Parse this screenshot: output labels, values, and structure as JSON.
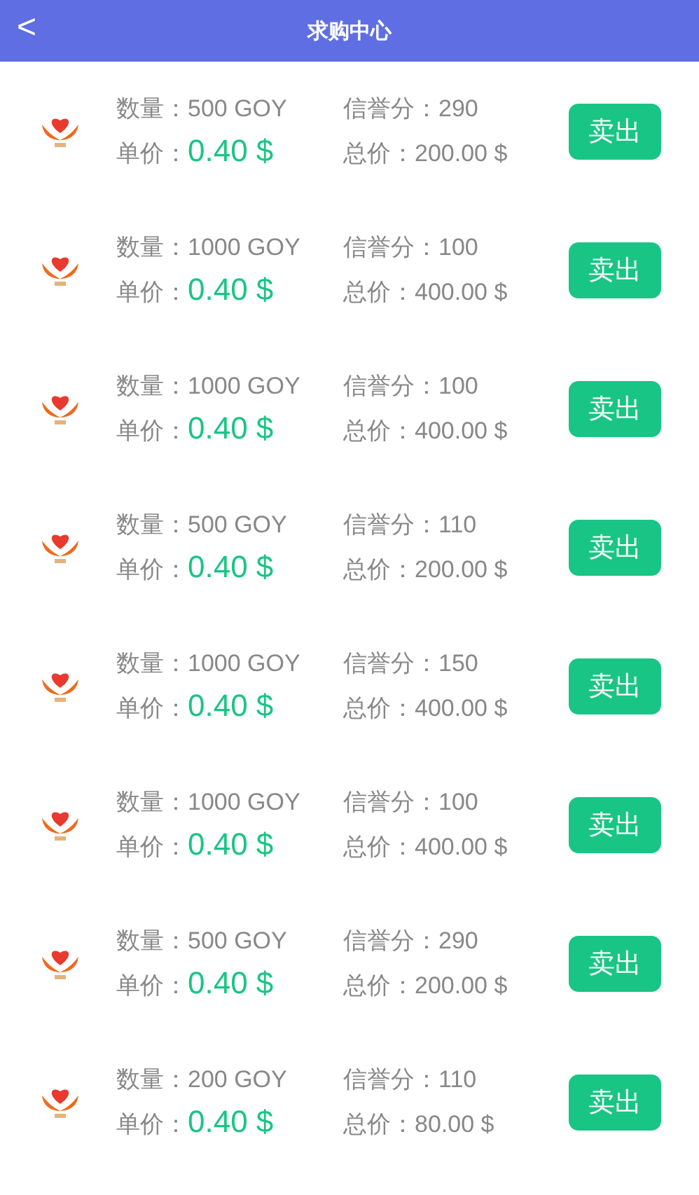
{
  "header": {
    "back": "<",
    "title": "求购中心"
  },
  "orders": [
    {
      "quantity_label": "数量：",
      "quantity": "500 GOY",
      "credit_label": "信誉分：",
      "credit": "290",
      "price_label": "单价：",
      "price": "0.40 $",
      "total_label": "总价：",
      "total": "200.00 $",
      "action": "卖出"
    },
    {
      "quantity_label": "数量：",
      "quantity": "1000 GOY",
      "credit_label": "信誉分：",
      "credit": "100",
      "price_label": "单价：",
      "price": "0.40 $",
      "total_label": "总价：",
      "total": "400.00 $",
      "action": "卖出"
    },
    {
      "quantity_label": "数量：",
      "quantity": "1000 GOY",
      "credit_label": "信誉分：",
      "credit": "100",
      "price_label": "单价：",
      "price": "0.40 $",
      "total_label": "总价：",
      "total": "400.00 $",
      "action": "卖出"
    },
    {
      "quantity_label": "数量：",
      "quantity": "500 GOY",
      "credit_label": "信誉分：",
      "credit": "110",
      "price_label": "单价：",
      "price": "0.40 $",
      "total_label": "总价：",
      "total": "200.00 $",
      "action": "卖出"
    },
    {
      "quantity_label": "数量：",
      "quantity": "1000 GOY",
      "credit_label": "信誉分：",
      "credit": "150",
      "price_label": "单价：",
      "price": "0.40 $",
      "total_label": "总价：",
      "total": "400.00 $",
      "action": "卖出"
    },
    {
      "quantity_label": "数量：",
      "quantity": "1000 GOY",
      "credit_label": "信誉分：",
      "credit": "100",
      "price_label": "单价：",
      "price": "0.40 $",
      "total_label": "总价：",
      "total": "400.00 $",
      "action": "卖出"
    },
    {
      "quantity_label": "数量：",
      "quantity": "500 GOY",
      "credit_label": "信誉分：",
      "credit": "290",
      "price_label": "单价：",
      "price": "0.40 $",
      "total_label": "总价：",
      "total": "200.00 $",
      "action": "卖出"
    },
    {
      "quantity_label": "数量：",
      "quantity": "200 GOY",
      "credit_label": "信誉分：",
      "credit": "110",
      "price_label": "单价：",
      "price": "0.40 $",
      "total_label": "总价：",
      "total": "80.00 $",
      "action": "卖出"
    }
  ]
}
